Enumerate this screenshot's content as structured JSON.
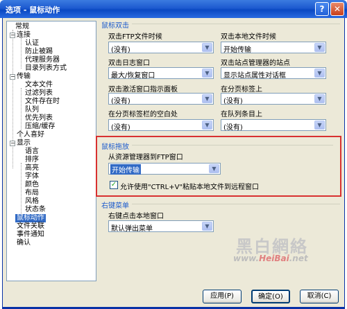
{
  "window": {
    "title": "选项 - 鼠标动作",
    "help_label": "?",
    "close_label": "✕"
  },
  "tree": {
    "items": [
      "常规",
      "连接",
      "认证",
      "防止被踢",
      "代理服务器",
      "目录列表方式",
      "传输",
      "文本文件",
      "过滤列表",
      "文件存在时",
      "队列",
      "优先列表",
      "压缩/缓存",
      "个人喜好",
      "显示",
      "语言",
      "排序",
      "高亮",
      "字体",
      "颜色",
      "布局",
      "风格",
      "状态条",
      "鼠标动作",
      "文件关联",
      "事件通知",
      "确认"
    ],
    "expander_open": "−"
  },
  "dblclick": {
    "title": "鼠标双击",
    "ftp_file": {
      "label": "双击FTP文件时候",
      "value": "(没有)"
    },
    "local_file": {
      "label": "双击本地文件时候",
      "value": "开始传输"
    },
    "log_window": {
      "label": "双击日志窗口",
      "value": "最大/恢复窗口"
    },
    "site_manager": {
      "label": "双击站点管理器的站点",
      "value": "显示站点属性对话框"
    },
    "active_panel": {
      "label": "双击激活窗口指示面板",
      "value": "(没有)"
    },
    "page_tab": {
      "label": "在分页标签上",
      "value": "(没有)"
    },
    "tab_blank": {
      "label": "在分页标签栏的空白处",
      "value": "(没有)"
    },
    "queue_item": {
      "label": "在队列条目上",
      "value": "(没有)"
    }
  },
  "drag": {
    "title": "鼠标拖放",
    "explorer_label": "从资源管理器到FTP窗口",
    "explorer_value": "开始传输",
    "paste_checkbox": "允许使用\"CTRL+V\"粘贴本地文件到远程窗口",
    "check_mark": "✓"
  },
  "context": {
    "title": "右键菜单",
    "local_label": "右键点击本地窗口",
    "local_value": "默认弹出菜单"
  },
  "arrow_glyph": "▼",
  "buttons": {
    "apply": "应用(P)",
    "ok": "确定(O)",
    "cancel": "取消(C)"
  },
  "watermark": {
    "big": "黑白網絡",
    "url_prefix": "www.",
    "url_brand": "HeiBai",
    "url_suffix": ".net"
  }
}
